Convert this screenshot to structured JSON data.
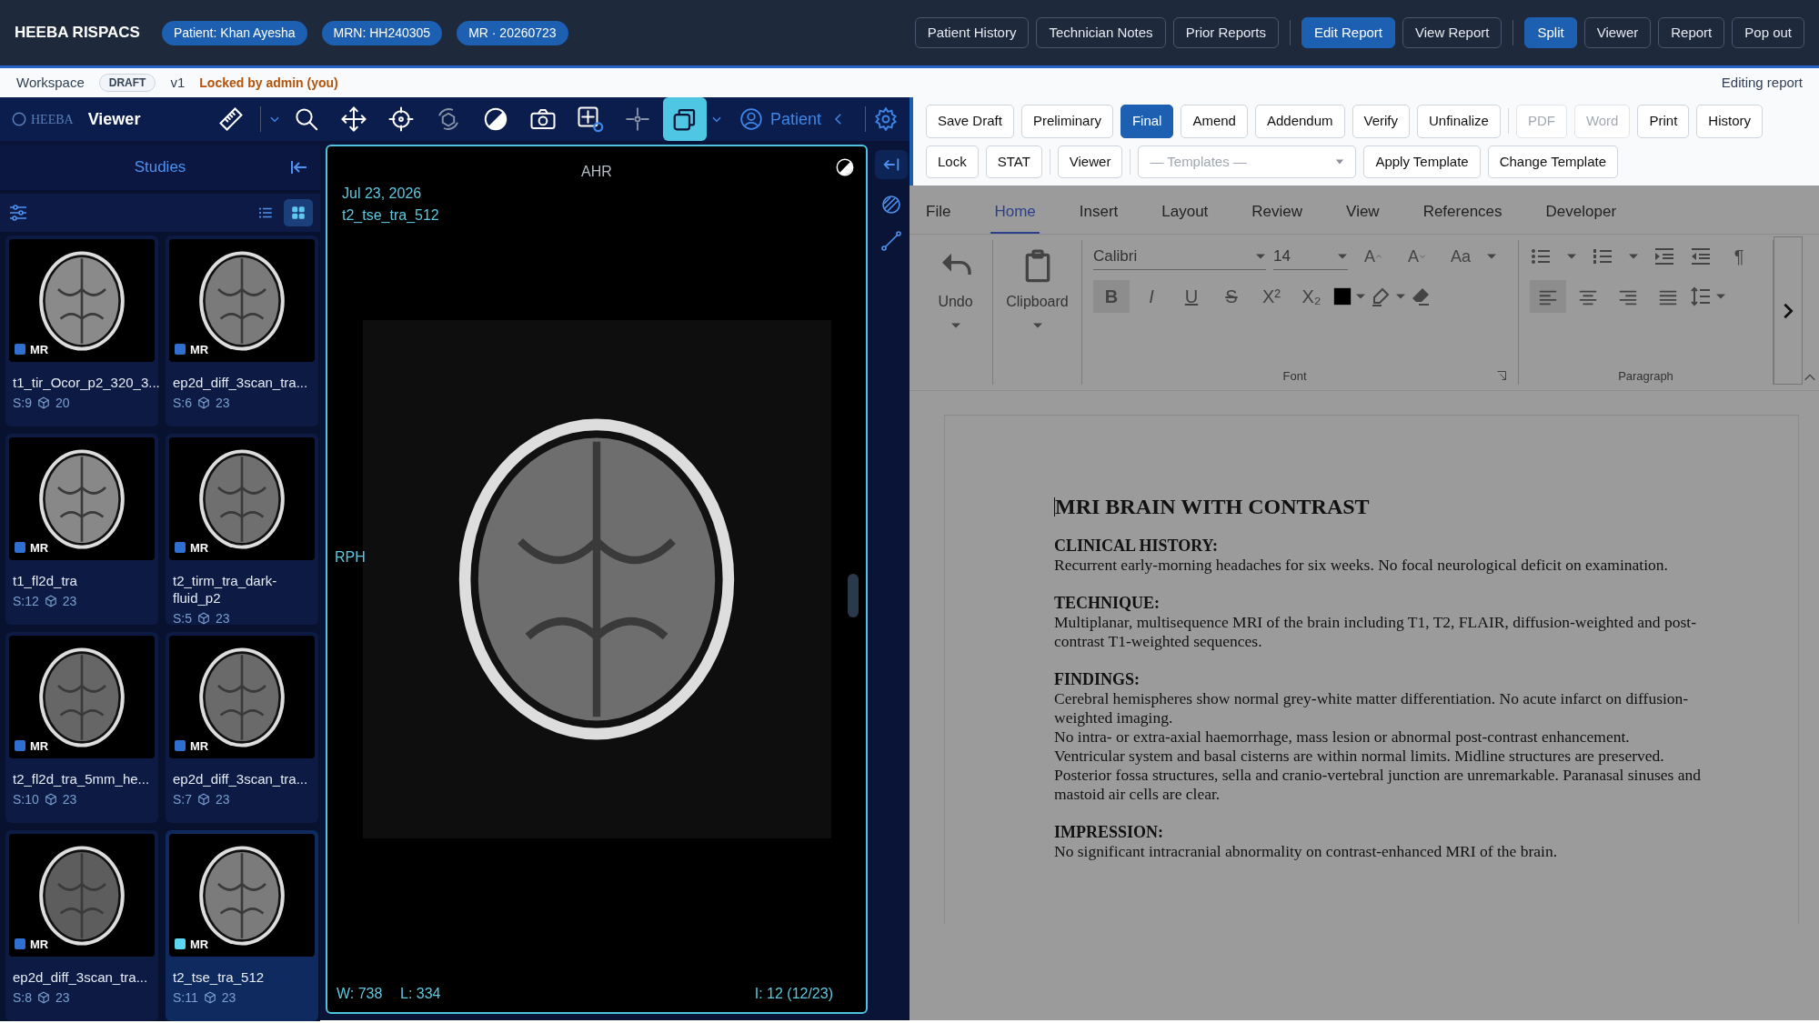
{
  "header": {
    "title": "HEEBA RISPACS",
    "pills": [
      "Patient: Khan Ayesha",
      "MRN: HH240305",
      "MR · 20260723"
    ],
    "button_groups": [
      [
        {
          "label": "Patient History",
          "selected": false
        },
        {
          "label": "Technician Notes",
          "selected": false
        },
        {
          "label": "Prior Reports",
          "selected": false
        }
      ],
      [
        {
          "label": "Edit Report",
          "selected": true
        },
        {
          "label": "View Report",
          "selected": false
        }
      ],
      [
        {
          "label": "Split",
          "selected": true
        },
        {
          "label": "Viewer",
          "selected": false
        },
        {
          "label": "Report",
          "selected": false
        },
        {
          "label": "Pop out",
          "selected": false
        }
      ]
    ]
  },
  "workspace": {
    "label": "Workspace",
    "status": "DRAFT",
    "version": "v1",
    "lock": "Locked by admin (you)",
    "mode": "Editing report"
  },
  "viewer": {
    "logo": "HEEBA",
    "title": "Viewer",
    "tools": [
      {
        "selected": false
      },
      {
        "selected": false
      },
      {
        "selected": false
      },
      {
        "selected": false
      },
      {
        "selected": false
      },
      {
        "selected": false
      },
      {
        "selected": false
      },
      {
        "selected": false
      },
      {
        "selected": false
      },
      {
        "selected": true
      }
    ],
    "patient_button": "Patient",
    "studies": {
      "title": "Studies",
      "view_modes": [
        {
          "selected": false
        },
        {
          "selected": true
        }
      ],
      "series": [
        {
          "name": "t1_tir_Ocor_p2_320_3...",
          "modality": "MR",
          "number": "S:9",
          "count": "20",
          "selected": false
        },
        {
          "name": "ep2d_diff_3scan_tra...",
          "modality": "MR",
          "number": "S:6",
          "count": "23",
          "selected": false
        },
        {
          "name": "t1_fl2d_tra",
          "modality": "MR",
          "number": "S:12",
          "count": "23",
          "selected": false
        },
        {
          "name": "t2_tirm_tra_dark-fluid_p2",
          "modality": "MR",
          "number": "S:5",
          "count": "23",
          "selected": false
        },
        {
          "name": "t2_fl2d_tra_5mm_he...",
          "modality": "MR",
          "number": "S:10",
          "count": "23",
          "selected": false
        },
        {
          "name": "ep2d_diff_3scan_tra...",
          "modality": "MR",
          "number": "S:7",
          "count": "23",
          "selected": false
        },
        {
          "name": "ep2d_diff_3scan_tra...",
          "modality": "MR",
          "number": "S:8",
          "count": "23",
          "selected": false
        },
        {
          "name": "t2_tse_tra_512",
          "modality": "MR",
          "number": "S:11",
          "count": "23",
          "selected": true
        }
      ]
    },
    "viewport": {
      "orientation_top": "AHR",
      "orientation_left": "RPH",
      "date": "Jul 23, 2026",
      "series": "t2_tse_tra_512",
      "window": "W: 738",
      "level_text": "L: 334",
      "image_index": "I: 12 (12/23)"
    }
  },
  "editor": {
    "action_rows": [
      [
        [
          {
            "label": "Save Draft",
            "selected": false,
            "disabled": false
          },
          {
            "label": "Preliminary",
            "selected": false,
            "disabled": false
          },
          {
            "label": "Final",
            "selected": true,
            "disabled": false
          },
          {
            "label": "Amend",
            "selected": false,
            "disabled": false
          },
          {
            "label": "Addendum",
            "selected": false,
            "disabled": false
          },
          {
            "label": "Verify",
            "selected": false,
            "disabled": false
          },
          {
            "label": "Unfinalize",
            "selected": false,
            "disabled": false
          }
        ],
        [
          {
            "label": "PDF",
            "selected": false,
            "disabled": true
          },
          {
            "label": "Word",
            "selected": false,
            "disabled": true
          },
          {
            "label": "Print",
            "selected": false,
            "disabled": false
          },
          {
            "label": "History",
            "selected": false,
            "disabled": false
          }
        ]
      ],
      [
        [
          {
            "label": "Lock",
            "selected": false,
            "disabled": false
          },
          {
            "label": "STAT",
            "selected": false,
            "disabled": false
          }
        ],
        [
          {
            "label": "Viewer",
            "selected": false,
            "disabled": false
          }
        ]
      ]
    ],
    "template_select": {
      "placeholder": "— Templates —"
    },
    "template_buttons": [
      "Apply Template",
      "Change Template"
    ],
    "ribbon_tabs": [
      {
        "label": "File",
        "selected": false
      },
      {
        "label": "Home",
        "selected": true
      },
      {
        "label": "Insert",
        "selected": false
      },
      {
        "label": "Layout",
        "selected": false
      },
      {
        "label": "Review",
        "selected": false
      },
      {
        "label": "View",
        "selected": false
      },
      {
        "label": "References",
        "selected": false
      },
      {
        "label": "Developer",
        "selected": false
      }
    ],
    "ribbon": {
      "undo": "Undo",
      "clipboard": "Clipboard",
      "font_name": "Calibri",
      "font_size": "14",
      "font_tools": [
        "A",
        "A",
        "Aa"
      ],
      "format_buttons": [
        {
          "label": "B",
          "selected": true
        },
        {
          "label": "I",
          "selected": false
        },
        {
          "label": "U",
          "selected": false
        },
        {
          "label": "S",
          "selected": false
        },
        {
          "label": "X²",
          "selected": false
        },
        {
          "label": "X₂",
          "selected": false
        }
      ],
      "pilcrow": "¶",
      "alignments": [
        {
          "selected": true
        },
        {
          "selected": false
        },
        {
          "selected": false
        },
        {
          "selected": false
        }
      ],
      "group_labels": [
        "Font",
        "Paragraph"
      ]
    },
    "document": {
      "title": "MRI BRAIN WITH CONTRAST",
      "sections": [
        {
          "heading": "CLINICAL HISTORY:",
          "lines": [
            "Recurrent early-morning headaches for six weeks. No focal neurological deficit on examination."
          ]
        },
        {
          "heading": "TECHNIQUE:",
          "lines": [
            "Multiplanar, multisequence MRI of the brain including T1, T2, FLAIR, diffusion-weighted and post-contrast T1-weighted sequences."
          ]
        },
        {
          "heading": "FINDINGS:",
          "lines": [
            "Cerebral hemispheres show normal grey-white matter differentiation. No acute infarct on diffusion-weighted imaging.",
            "No intra- or extra-axial haemorrhage, mass lesion or abnormal post-contrast enhancement.",
            "Ventricular system and basal cisterns are within normal limits. Midline structures are preserved.",
            "Posterior fossa structures, sella and cranio-vertebral junction are unremarkable. Paranasal sinuses and mastoid air cells are clear."
          ]
        },
        {
          "heading": "IMPRESSION:",
          "lines": [
            "No significant intracranial abnormality on contrast-enhanced MRI of the brain."
          ]
        }
      ]
    }
  }
}
